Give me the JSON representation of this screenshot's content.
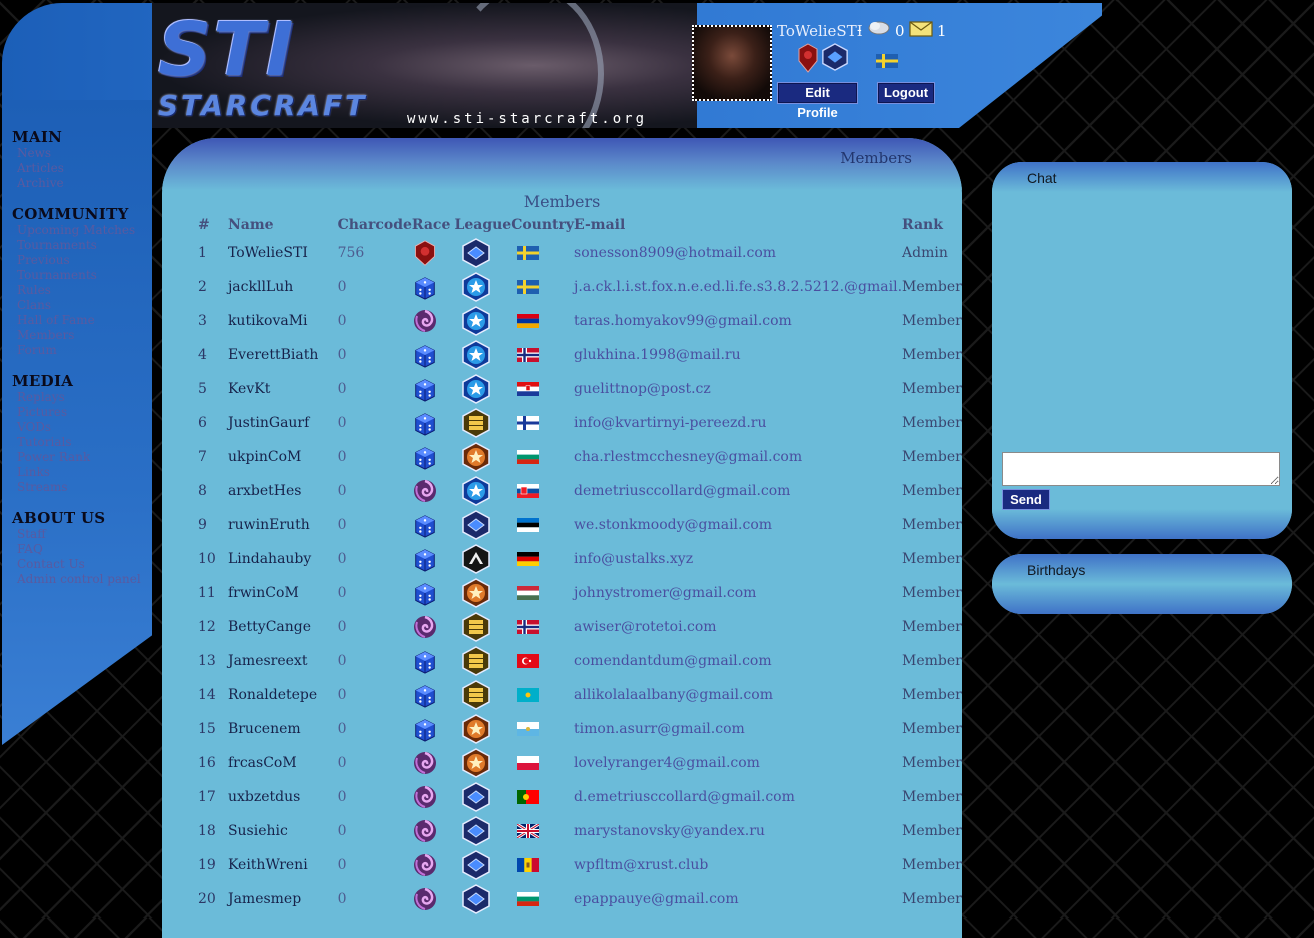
{
  "header": {
    "logo_main": "STI",
    "logo_sub": "STARCRAFT",
    "site_url": "www.sti-starcraft.org",
    "username": "ToWelieSTI",
    "separator": "-",
    "notifications_count": "0",
    "messages_count": "1",
    "edit_profile_label": "Edit Profile",
    "logout_label": "Logout",
    "user_race": "terran",
    "user_league": "diamond",
    "user_flag": "se"
  },
  "nav": {
    "sections": [
      {
        "title": "MAIN",
        "items": [
          "News",
          "Articles",
          "Archive"
        ]
      },
      {
        "title": "COMMUNITY",
        "items": [
          "Upcoming Matches",
          "Tournaments",
          "Previous Tournaments",
          "Rules",
          "Clans",
          "Hall of Fame",
          "Members",
          "Forum"
        ]
      },
      {
        "title": "MEDIA",
        "items": [
          "Replays",
          "Pictures",
          "VODs",
          "Tutorials",
          "Power Rank",
          "Links",
          "Streams"
        ]
      },
      {
        "title": "ABOUT US",
        "items": [
          "Staff",
          "FAQ",
          "Contact Us",
          "Admin control panel"
        ]
      }
    ]
  },
  "main": {
    "header_title": "Members",
    "caption": "Members",
    "columns": {
      "num": "#",
      "name": "Name",
      "charcode": "Charcode",
      "race": "Race",
      "league": "League",
      "country": "Country",
      "email": "E-mail",
      "rank": "Rank"
    },
    "rows": [
      {
        "num": "1",
        "name": "ToWelieSTI",
        "charcode": "756",
        "race": "terran",
        "league": "diamond",
        "country": "se",
        "email": "sonesson8909@hotmail.com",
        "rank": "Admin"
      },
      {
        "num": "2",
        "name": "jackllLuh",
        "charcode": "0",
        "race": "random",
        "league": "master",
        "country": "se",
        "email": "j.a.ck.l.i.st.fox.n.e.ed.li.fe.s3.8.2.5212.@gmail.",
        "rank": "Member"
      },
      {
        "num": "3",
        "name": "kutikovaMi",
        "charcode": "0",
        "race": "zerg",
        "league": "master",
        "country": "am",
        "email": "taras.homyakov99@gmail.com",
        "rank": "Member"
      },
      {
        "num": "4",
        "name": "EverettBiath",
        "charcode": "0",
        "race": "random",
        "league": "master",
        "country": "no",
        "email": "glukhina.1998@mail.ru",
        "rank": "Member"
      },
      {
        "num": "5",
        "name": "KevKt",
        "charcode": "0",
        "race": "random",
        "league": "master",
        "country": "hr",
        "email": "guelittnop@post.cz",
        "rank": "Member"
      },
      {
        "num": "6",
        "name": "JustinGaurf",
        "charcode": "0",
        "race": "random",
        "league": "gold",
        "country": "fi",
        "email": "info@kvartirnyi-pereezd.ru",
        "rank": "Member"
      },
      {
        "num": "7",
        "name": "ukpinCoM",
        "charcode": "0",
        "race": "random",
        "league": "bronze",
        "country": "bg",
        "email": "cha.rlestmcchesney@gmail.com",
        "rank": "Member"
      },
      {
        "num": "8",
        "name": "arxbetHes",
        "charcode": "0",
        "race": "zerg",
        "league": "master",
        "country": "sk",
        "email": "demetriusccollard@gmail.com",
        "rank": "Member"
      },
      {
        "num": "9",
        "name": "ruwinEruth",
        "charcode": "0",
        "race": "random",
        "league": "diamond",
        "country": "ee",
        "email": "we.stonkmoody@gmail.com",
        "rank": "Member"
      },
      {
        "num": "10",
        "name": "Lindahauby",
        "charcode": "0",
        "race": "random",
        "league": "grandmaster",
        "country": "de",
        "email": "info@ustalks.xyz",
        "rank": "Member"
      },
      {
        "num": "11",
        "name": "frwinCoM",
        "charcode": "0",
        "race": "random",
        "league": "bronze",
        "country": "hu",
        "email": "johnystromer@gmail.com",
        "rank": "Member"
      },
      {
        "num": "12",
        "name": "BettyCange",
        "charcode": "0",
        "race": "zerg",
        "league": "gold",
        "country": "no",
        "email": "awiser@rotetoi.com",
        "rank": "Member"
      },
      {
        "num": "13",
        "name": "Jamesreext",
        "charcode": "0",
        "race": "random",
        "league": "gold",
        "country": "tr",
        "email": "comendantdum@gmail.com",
        "rank": "Member"
      },
      {
        "num": "14",
        "name": "Ronaldetepe",
        "charcode": "0",
        "race": "random",
        "league": "gold",
        "country": "kz",
        "email": "allikolalaalbany@gmail.com",
        "rank": "Member"
      },
      {
        "num": "15",
        "name": "Brucenem",
        "charcode": "0",
        "race": "random",
        "league": "bronze",
        "country": "sm",
        "email": "timon.asurr@gmail.com",
        "rank": "Member"
      },
      {
        "num": "16",
        "name": "frcasCoM",
        "charcode": "0",
        "race": "zerg",
        "league": "bronze",
        "country": "pl",
        "email": "lovelyranger4@gmail.com",
        "rank": "Member"
      },
      {
        "num": "17",
        "name": "uxbzetdus",
        "charcode": "0",
        "race": "zerg",
        "league": "diamond",
        "country": "pt",
        "email": "d.emetriusccollard@gmail.com",
        "rank": "Member"
      },
      {
        "num": "18",
        "name": "Susiehic",
        "charcode": "0",
        "race": "zerg",
        "league": "diamond",
        "country": "gb",
        "email": "marystanovsky@yandex.ru",
        "rank": "Member"
      },
      {
        "num": "19",
        "name": "KeithWreni",
        "charcode": "0",
        "race": "zerg",
        "league": "diamond",
        "country": "md",
        "email": "wpfltm@xrust.club",
        "rank": "Member"
      },
      {
        "num": "20",
        "name": "Jamesmep",
        "charcode": "0",
        "race": "zerg",
        "league": "diamond",
        "country": "bg",
        "email": "epappauye@gmail.com",
        "rank": "Member"
      }
    ]
  },
  "sidebar": {
    "chat_title": "Chat",
    "chat_send_label": "Send",
    "chat_input_value": "",
    "birthdays_title": "Birthdays"
  },
  "colors": {
    "panel_bg": "#6bbbd9",
    "frame_blue": "#2a72cf",
    "button_bg": "#1a2a80"
  }
}
